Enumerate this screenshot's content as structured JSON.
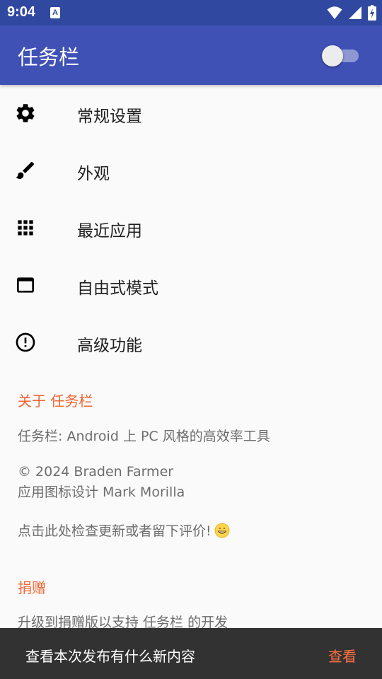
{
  "status_bar": {
    "time": "9:04",
    "notification_icon_letter": "A"
  },
  "app_bar": {
    "title": "任务栏",
    "switch_on": false
  },
  "menu": [
    {
      "label": "常规设置",
      "icon": "gear-icon"
    },
    {
      "label": "外观",
      "icon": "brush-icon"
    },
    {
      "label": "最近应用",
      "icon": "grid-icon"
    },
    {
      "label": "自由式模式",
      "icon": "window-icon"
    },
    {
      "label": "高级功能",
      "icon": "alert-circle-icon"
    }
  ],
  "about": {
    "header": "关于 任务栏",
    "description": "任务栏: Android 上 PC 风格的高效率工具",
    "copyright": "© 2024 Braden Farmer",
    "icon_credit": "应用图标设计 Mark Morilla",
    "update_prompt": "点击此处检查更新或者留下评价!",
    "update_emoji": "grinning-face-emoji"
  },
  "donate": {
    "header": "捐赠",
    "description": "升级到捐赠版以支持 任务栏 的开发"
  },
  "snackbar": {
    "message": "查看本次发布有什么新内容",
    "action": "查看"
  },
  "colors": {
    "status_bar": "#3048a0",
    "app_bar": "#3f51b5",
    "accent": "#f06430",
    "snackbar_bg": "#323232",
    "snackbar_action": "#ff7043"
  }
}
